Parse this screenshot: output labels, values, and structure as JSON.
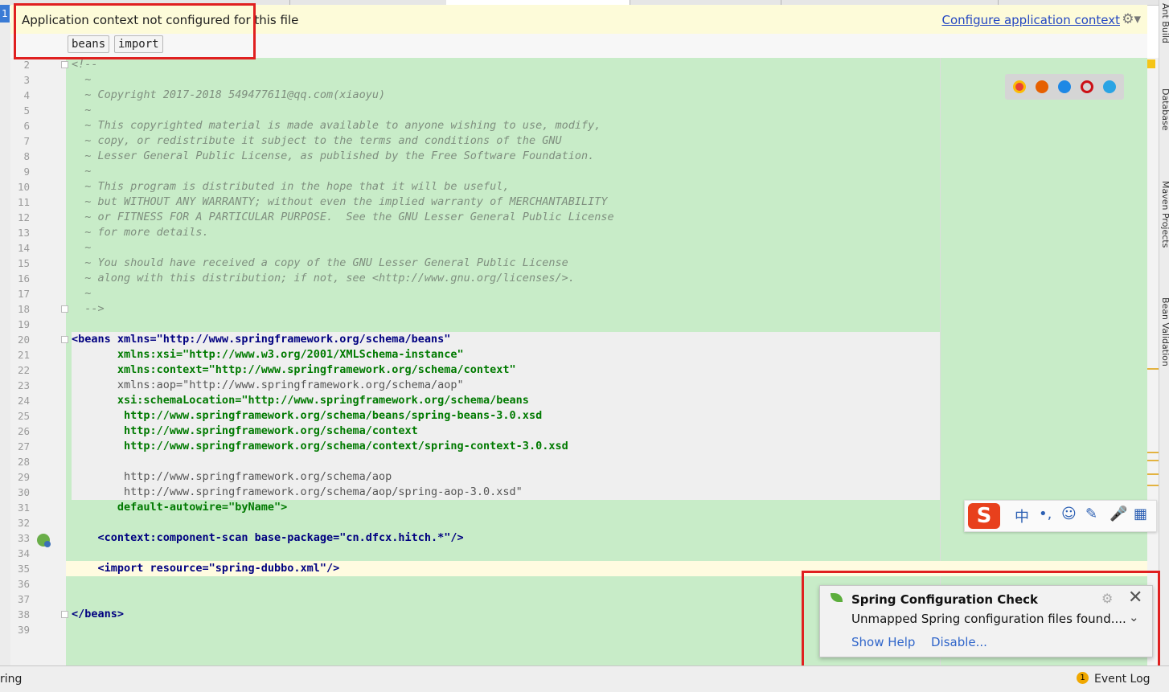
{
  "banner": {
    "message": "Application context not configured for this file",
    "link": "Configure application context",
    "gear_icon": "gear-dropdown-icon"
  },
  "breadcrumb_tags": [
    "beans",
    "import"
  ],
  "editor": {
    "lines": [
      {
        "n": 2,
        "text": "<!--",
        "kind": "comment"
      },
      {
        "n": 3,
        "text": "  ~",
        "kind": "comment"
      },
      {
        "n": 4,
        "text": "  ~ Copyright 2017-2018 549477611@qq.com(xiaoyu)",
        "kind": "comment"
      },
      {
        "n": 5,
        "text": "  ~",
        "kind": "comment"
      },
      {
        "n": 6,
        "text": "  ~ This copyrighted material is made available to anyone wishing to use, modify,",
        "kind": "comment"
      },
      {
        "n": 7,
        "text": "  ~ copy, or redistribute it subject to the terms and conditions of the GNU",
        "kind": "comment"
      },
      {
        "n": 8,
        "text": "  ~ Lesser General Public License, as published by the Free Software Foundation.",
        "kind": "comment"
      },
      {
        "n": 9,
        "text": "  ~",
        "kind": "comment"
      },
      {
        "n": 10,
        "text": "  ~ This program is distributed in the hope that it will be useful,",
        "kind": "comment"
      },
      {
        "n": 11,
        "text": "  ~ but WITHOUT ANY WARRANTY; without even the implied warranty of MERCHANTABILITY",
        "kind": "comment"
      },
      {
        "n": 12,
        "text": "  ~ or FITNESS FOR A PARTICULAR PURPOSE.  See the GNU Lesser General Public License",
        "kind": "comment"
      },
      {
        "n": 13,
        "text": "  ~ for more details.",
        "kind": "comment"
      },
      {
        "n": 14,
        "text": "  ~",
        "kind": "comment"
      },
      {
        "n": 15,
        "text": "  ~ You should have received a copy of the GNU Lesser General Public License",
        "kind": "comment"
      },
      {
        "n": 16,
        "text": "  ~ along with this distribution; if not, see <http://www.gnu.org/licenses/>.",
        "kind": "comment"
      },
      {
        "n": 17,
        "text": "  ~",
        "kind": "comment"
      },
      {
        "n": 18,
        "text": "  -->",
        "kind": "comment"
      },
      {
        "n": 19,
        "text": "",
        "kind": "plain"
      },
      {
        "n": 20,
        "text": "<beans xmlns=\"http://www.springframework.org/schema/beans\"",
        "kind": "tag"
      },
      {
        "n": 21,
        "text": "       xmlns:xsi=\"http://www.w3.org/2001/XMLSchema-instance\"",
        "kind": "attr"
      },
      {
        "n": 22,
        "text": "       xmlns:context=\"http://www.springframework.org/schema/context\"",
        "kind": "attr"
      },
      {
        "n": 23,
        "text": "       xmlns:aop=\"http://www.springframework.org/schema/aop\"",
        "kind": "schema"
      },
      {
        "n": 24,
        "text": "       xsi:schemaLocation=\"http://www.springframework.org/schema/beans",
        "kind": "attr"
      },
      {
        "n": 25,
        "text": "        http://www.springframework.org/schema/beans/spring-beans-3.0.xsd",
        "kind": "attr"
      },
      {
        "n": 26,
        "text": "        http://www.springframework.org/schema/context",
        "kind": "attr"
      },
      {
        "n": 27,
        "text": "        http://www.springframework.org/schema/context/spring-context-3.0.xsd",
        "kind": "attr"
      },
      {
        "n": 28,
        "text": "",
        "kind": "schema"
      },
      {
        "n": 29,
        "text": "        http://www.springframework.org/schema/aop",
        "kind": "schema"
      },
      {
        "n": 30,
        "text": "        http://www.springframework.org/schema/aop/spring-aop-3.0.xsd\"",
        "kind": "schema"
      },
      {
        "n": 31,
        "text": "       default-autowire=\"byName\">",
        "kind": "attr"
      },
      {
        "n": 32,
        "text": "",
        "kind": "plain"
      },
      {
        "n": 33,
        "text": "    <context:component-scan base-package=\"cn.dfcx.hitch.*\"/>",
        "kind": "tag"
      },
      {
        "n": 34,
        "text": "",
        "kind": "plain"
      },
      {
        "n": 35,
        "text": "    <import resource=\"spring-dubbo.xml\"/>",
        "kind": "tag"
      },
      {
        "n": 36,
        "text": "",
        "kind": "plain"
      },
      {
        "n": 37,
        "text": "",
        "kind": "plain"
      },
      {
        "n": 38,
        "text": "</beans>",
        "kind": "tag"
      },
      {
        "n": 39,
        "text": "",
        "kind": "plain"
      }
    ]
  },
  "browser_icons": [
    "chrome-icon",
    "firefox-icon",
    "safari-icon",
    "opera-icon",
    "ie-icon"
  ],
  "ime_toolbar": {
    "logo": "S",
    "items": [
      "中",
      "•,",
      "☺",
      "✎",
      "🎤",
      "▦"
    ]
  },
  "notification": {
    "title": "Spring Configuration Check",
    "body": "Unmapped Spring configuration files found....",
    "actions": [
      "Show Help",
      "Disable..."
    ]
  },
  "right_tool_windows": [
    "Ant Build",
    "Database",
    "Maven Projects",
    "Bean Validation"
  ],
  "status_bar": {
    "left_text": "ring",
    "event_count": "1",
    "event_log": "Event Log"
  },
  "colors": {
    "editor_bg": "#c8ecc8",
    "banner_bg": "#fdfbd9",
    "highlight_red": "#e02020",
    "link_blue": "#2447c2"
  }
}
